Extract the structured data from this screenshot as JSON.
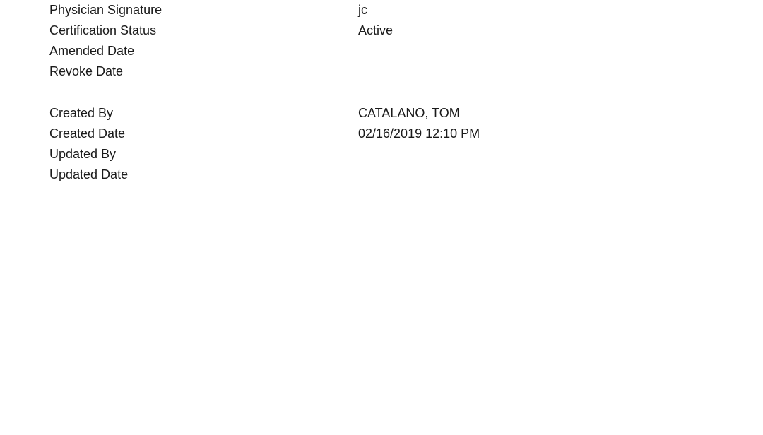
{
  "certification": {
    "physician_signature": {
      "label": "Physician Signature",
      "value": "jc"
    },
    "certification_status": {
      "label": "Certification Status",
      "value": "Active"
    },
    "amended_date": {
      "label": "Amended Date",
      "value": ""
    },
    "revoke_date": {
      "label": "Revoke Date",
      "value": ""
    }
  },
  "audit": {
    "created_by": {
      "label": "Created By",
      "value": "CATALANO, TOM"
    },
    "created_date": {
      "label": "Created Date",
      "value": "02/16/2019 12:10 PM"
    },
    "updated_by": {
      "label": "Updated By",
      "value": ""
    },
    "updated_date": {
      "label": "Updated Date",
      "value": ""
    }
  }
}
